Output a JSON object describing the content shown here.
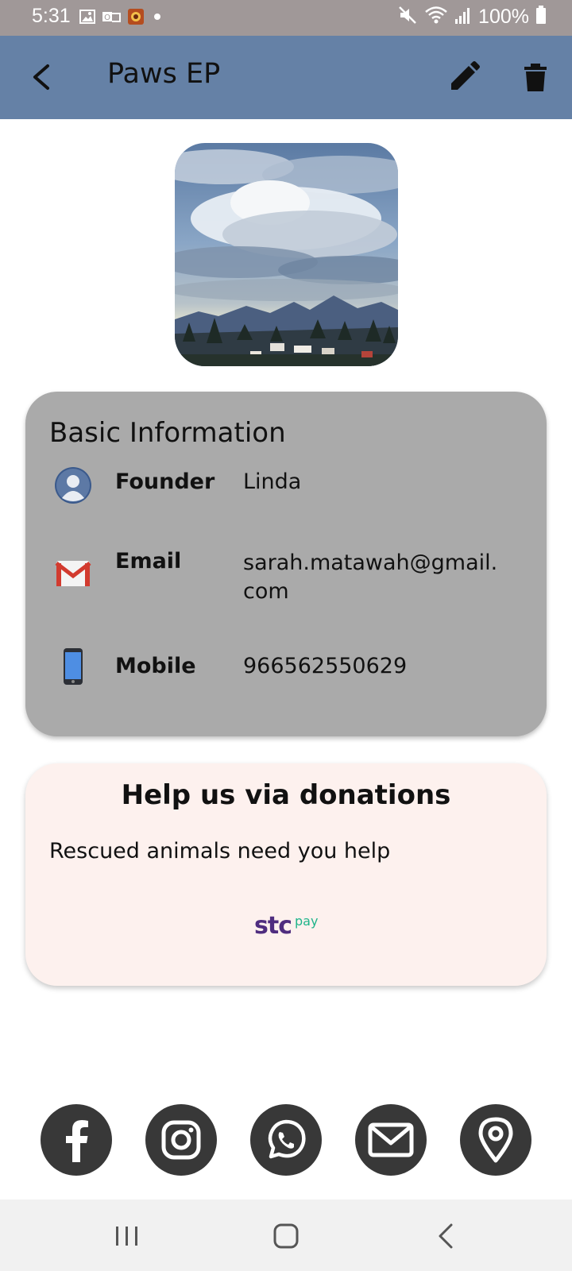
{
  "status_bar": {
    "time": "5:31",
    "battery": "100%",
    "left_icons": [
      "image-icon",
      "outlook-icon",
      "app-notification-icon",
      "dot-icon"
    ],
    "right_icons": [
      "mute-icon",
      "wifi-icon",
      "signal-icon",
      "battery-icon"
    ]
  },
  "app_bar": {
    "title": "Paws EP",
    "background": "#6581a6"
  },
  "basic_info": {
    "heading": "Basic Information",
    "rows": [
      {
        "icon": "user-avatar-icon",
        "label": "Founder",
        "value": "Linda"
      },
      {
        "icon": "gmail-icon",
        "label": "Email",
        "value": "sarah.matawah@gmail.com"
      },
      {
        "icon": "phone-icon",
        "label": "Mobile",
        "value": "966562550629"
      }
    ]
  },
  "donations": {
    "title": "Help us via donations",
    "text": "Rescued animals need you help",
    "payment_logo": {
      "main": "stc",
      "suffix": "pay"
    }
  },
  "social_links": [
    "facebook-icon",
    "instagram-icon",
    "whatsapp-icon",
    "mail-icon",
    "location-pin-icon"
  ],
  "nav_bar": [
    "recent-apps-icon",
    "home-icon",
    "back-icon"
  ],
  "colors": {
    "status_bar": "#a09898",
    "app_bar": "#6581a6",
    "info_card": "#aaaaaa",
    "donation_card": "#fdf1ee",
    "social_button": "#383838",
    "stc_purple": "#4f2d7f",
    "stc_green": "#1fb48a"
  }
}
